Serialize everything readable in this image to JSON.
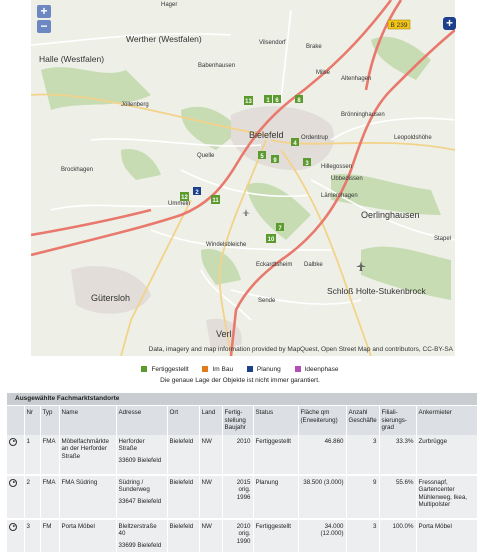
{
  "map": {
    "zoom_in": "+",
    "zoom_out": "−",
    "layer_button": "+",
    "place_labels": {
      "hager": "Hager",
      "werther": "Werther (Westfalen)",
      "vilsendorf": "Vilsendorf",
      "brake": "Brake",
      "halle": "Halle (Westfalen)",
      "babenhausen": "Babenhausen",
      "milse": "Milse",
      "altenhagen": "Altenhagen",
      "jollenbeck": "Jöllenberg",
      "bronninghausen": "Brönninghausen",
      "bielefeld": "Bielefeld",
      "ordenbrock": "Ordentrup",
      "leopoldshohe": "Leopoldshöhe",
      "quelle": "Quelle",
      "brockhagen": "Brockhagen",
      "hillegossen": "Hillegossen",
      "ubbedissen": "Ubbedissen",
      "lamershagen": "Lämershagen",
      "ummeln": "Ummeln",
      "oerlinghausen": "Oerlinghausen",
      "stapel": "Stapel",
      "windelsbleiche": "Windelsbleiche",
      "eckardtsheim": "Eckardtsheim",
      "dalbke": "Dalbke",
      "schloss": "Schloß Holte-Stukenbrock",
      "gutersloh": "Gütersloh",
      "sende": "Sende",
      "verl": "Verl",
      "road_b239": "B 239"
    },
    "markers": [
      {
        "id": "1",
        "status": "fertig"
      },
      {
        "id": "2",
        "status": "planung"
      },
      {
        "id": "3",
        "status": "fertig"
      },
      {
        "id": "4",
        "status": "fertig"
      },
      {
        "id": "5",
        "status": "fertig"
      },
      {
        "id": "6",
        "status": "fertig"
      },
      {
        "id": "7",
        "status": "fertig"
      },
      {
        "id": "8",
        "status": "fertig"
      },
      {
        "id": "9",
        "status": "fertig"
      },
      {
        "id": "10",
        "status": "fertig"
      },
      {
        "id": "11",
        "status": "fertig"
      },
      {
        "id": "12",
        "status": "fertig"
      },
      {
        "id": "13",
        "status": "fertig"
      }
    ],
    "attribution": "Data, imagery and map information provided by MapQuest, Open Street Map and contributors, CC-BY-SA"
  },
  "colors": {
    "fertig": "#5a9a2e",
    "inbau": "#e07a1c",
    "planung": "#1e3f8c",
    "ideen": "#b44db4",
    "highway": "#e86a5a"
  },
  "legend": {
    "fertig": "Fertiggestellt",
    "inbau": "Im Bau",
    "planung": "Planung",
    "ideen": "Ideenphase"
  },
  "note": "Die genaue Lage der Objekte ist nicht immer garantiert.",
  "table": {
    "title": "Ausgewählte Fachmarktstandorte",
    "headers": {
      "nr": "Nr",
      "typ": "Typ",
      "name": "Name",
      "adresse": "Adresse",
      "ort": "Ort",
      "land": "Land",
      "fertig": "Fertig-stellung Baujahr",
      "status": "Status",
      "flaeche": "Fläche qm (Erweiterung)",
      "anzahl": "Anzahl Geschäfte",
      "filial": "Filiali-sierungs-grad",
      "anker": "Ankermieter"
    },
    "rows": [
      {
        "nr": "1",
        "typ": "FMA",
        "name": "Möbelfachmärkte an der Herforder Straße",
        "adresse1": "Herforder Straße",
        "adresse2": "33609 Bielefeld",
        "ort": "Bielefeld",
        "land": "NW",
        "fertig": "2010",
        "status": "Fertiggestellt",
        "flaeche": "46.860",
        "anzahl": "3",
        "filial": "33.3%",
        "anker": "Zurbrügge"
      },
      {
        "nr": "2",
        "typ": "FMA",
        "name": "FMA Südring",
        "adresse1": "Südring / Sunderweg",
        "adresse2": "33647 Bielefeld",
        "ort": "Bielefeld",
        "land": "NW",
        "fertig": "2015 orig. 1996",
        "status": "Planung",
        "flaeche": "38.500 (3.000)",
        "anzahl": "9",
        "filial": "55.6%",
        "anker": "Fressnapf, Gartencenter Mühlenweg, Ikea, Multipolster"
      },
      {
        "nr": "3",
        "typ": "FM",
        "name": "Porta Möbel",
        "adresse1": "Bleltzerstraße 40",
        "adresse2": "33699 Bielefeld",
        "ort": "Bielefeld",
        "land": "NW",
        "fertig": "2010 orig. 1990",
        "status": "Fertiggestellt",
        "flaeche": "34.000 (12.000)",
        "anzahl": "3",
        "filial": "100.0%",
        "anker": "Porta Möbel"
      }
    ]
  }
}
